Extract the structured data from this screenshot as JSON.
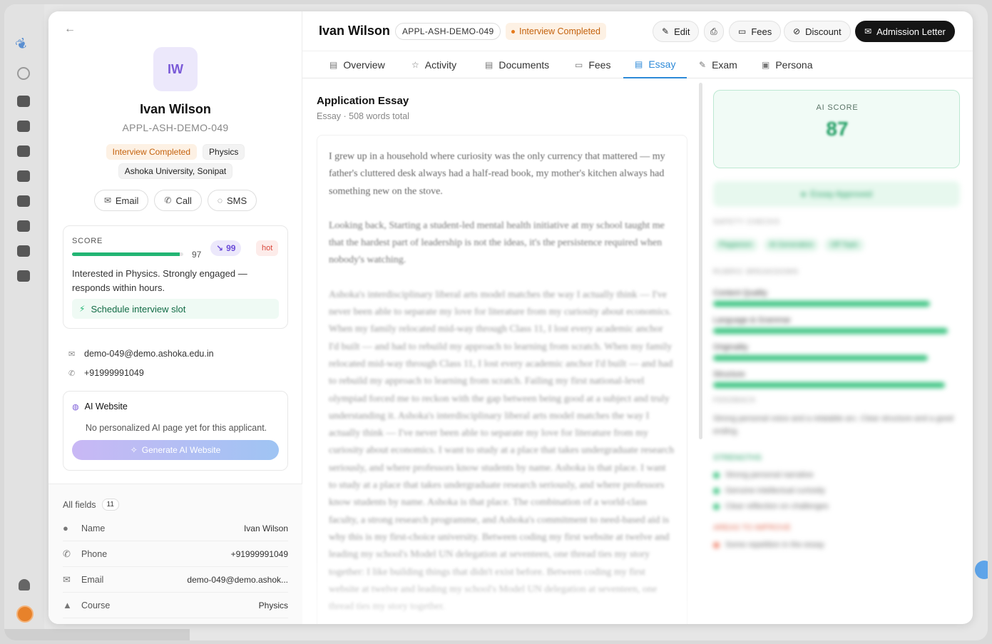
{
  "profile": {
    "initials": "IW",
    "name": "Ivan Wilson",
    "app_id": "APPL-ASH-DEMO-049",
    "tags": [
      "Interview Completed",
      "Physics"
    ],
    "university": "Ashoka University, Sonipat",
    "actions": {
      "email": "Email",
      "call": "Call",
      "sms": "SMS"
    }
  },
  "score_card": {
    "label": "SCORE",
    "value": "97",
    "progress": 0.97,
    "badge": "99",
    "hot": "hot",
    "summary": "Interested in Physics. Strongly engaged — responds within hours.",
    "action": "Schedule interview slot"
  },
  "contact": {
    "email": "demo-049@demo.ashoka.edu.in",
    "phone": "+91999991049"
  },
  "ai_website": {
    "title": "AI Website",
    "status": "No personalized AI page yet for this applicant.",
    "button": "Generate AI Website"
  },
  "fields": {
    "title": "All fields",
    "count": "11",
    "rows": [
      {
        "label": "Name",
        "value": "Ivan Wilson",
        "icon": "person-icon"
      },
      {
        "label": "Phone",
        "value": "+91999991049",
        "icon": "phone-icon"
      },
      {
        "label": "Email",
        "value": "demo-049@demo.ashok...",
        "icon": "email-icon"
      },
      {
        "label": "Course",
        "value": "Physics",
        "icon": "graduation-cap-icon"
      }
    ]
  },
  "header": {
    "name": "Ivan Wilson",
    "app_id": "APPL-ASH-DEMO-049",
    "status": "Interview Completed",
    "buttons": {
      "edit": "Edit",
      "fees": "Fees",
      "discount": "Discount",
      "admission": "Admission Letter"
    }
  },
  "tabs": [
    "Overview",
    "Activity",
    "Documents",
    "Fees",
    "Essay",
    "Exam",
    "Persona"
  ],
  "active_tab": "Essay",
  "essay": {
    "title": "Application Essay",
    "subtitle": "Essay · 508 words total",
    "paragraphs": [
      "I grew up in a household where curiosity was the only currency that mattered — my father's cluttered desk always had a half-read book, my mother's kitchen always had something new on the stove.",
      "Looking back, Starting a student-led mental health initiative at my school taught me that the hardest part of leadership is not the ideas, it's the persistence required when nobody's watching.",
      "Ashoka's interdisciplinary liberal arts model matches the way I actually think — I've never been able to separate my love for literature from my curiosity about economics. When my family relocated mid-way through Class 11, I lost every academic anchor I'd built — and had to rebuild my approach to learning from scratch. When my family relocated mid-way through Class 11, I lost every academic anchor I'd built — and had to rebuild my approach to learning from scratch. Failing my first national-level olympiad forced me to reckon with the gap between being good at a subject and truly understanding it. Ashoka's interdisciplinary liberal arts model matches the way I actually think — I've never been able to separate my love for literature from my curiosity about economics. I want to study at a place that takes undergraduate research seriously, and where professors know students by name. Ashoka is that place. I want to study at a place that takes undergraduate research seriously, and where professors know students by name. Ashoka is that place. The combination of a world-class faculty, a strong research programme, and Ashoka's commitment to need-based aid is why this is my first-choice university. Between coding my first website at twelve and leading my school's Model UN delegation at seventeen, one thread ties my story together: I like building things that didn't exist before. Between coding my first website at twelve and leading my school's Model UN delegation at seventeen, one thread ties my story together."
    ]
  },
  "ai_score": {
    "label": "AI SCORE",
    "value": "87",
    "approved": "Essay Approved",
    "checks_title": "SAFETY CHECKS",
    "checks": [
      "Plagiarism",
      "AI Generation",
      "Off Topic"
    ],
    "rubric_title": "RUBRIC BREAKDOWN",
    "rubric": [
      {
        "name": "Content Quality",
        "score": 0.88
      },
      {
        "name": "Language & Grammar",
        "score": 0.95
      },
      {
        "name": "Originality",
        "score": 0.87
      },
      {
        "name": "Structure",
        "score": 0.94
      }
    ],
    "feedback_title": "FEEDBACK",
    "feedback": "Strong personal voice and a relatable arc. Clear structure and a good ending.",
    "strengths_title": "STRENGTHS",
    "strengths": [
      "Strong personal narrative",
      "Genuine intellectual curiosity",
      "Clear reflection on challenges"
    ],
    "improve_title": "AREAS TO IMPROVE",
    "improve": [
      "Some repetition in the essay"
    ]
  },
  "colors": {
    "accent": "#2d8ad8",
    "success": "#22b573",
    "warning": "#c4620d",
    "brand": "#7a5ad8"
  }
}
